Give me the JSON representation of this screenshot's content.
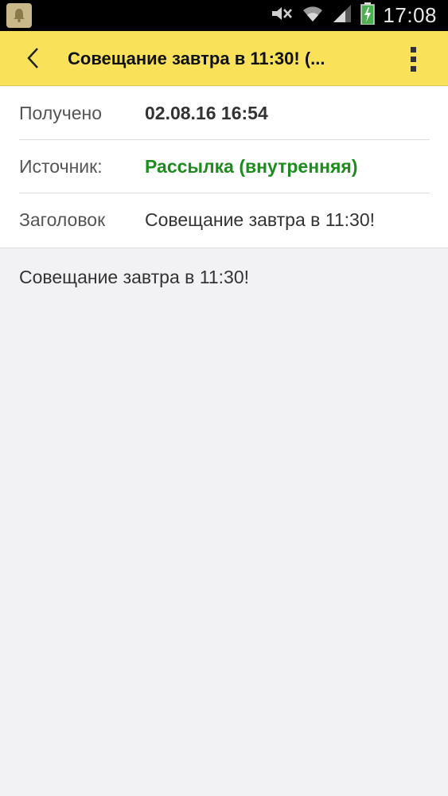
{
  "status_bar": {
    "time": "17:08",
    "icons": [
      "app-notification-icon",
      "mute-icon",
      "wifi-icon",
      "signal-icon",
      "battery-charging-icon"
    ]
  },
  "app_bar": {
    "title": "Совещание завтра в 11:30! (...",
    "back_icon": "chevron-left-icon",
    "menu_icon": "more-vertical-icon"
  },
  "details": [
    {
      "label": "Получено",
      "value": "02.08.16 16:54"
    },
    {
      "label": "Источник:",
      "value": "Рассылка (внутренняя)"
    },
    {
      "label": "Заголовок",
      "value": "Совещание завтра в 11:30!"
    }
  ],
  "body": {
    "text": "Совещание завтра в 11:30!"
  },
  "colors": {
    "app_bar": "#f9e25a",
    "source_value": "#1e8c1e",
    "background": "#f2f2f4"
  }
}
